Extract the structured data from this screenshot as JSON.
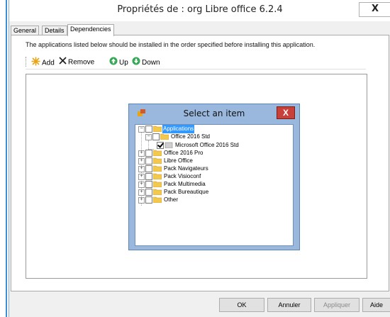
{
  "window": {
    "title": "Propriétés de : org Libre office 6.2.4",
    "close_glyph": "X"
  },
  "tabs": [
    {
      "label": "General",
      "active": false
    },
    {
      "label": "Details",
      "active": false
    },
    {
      "label": "Dependencies",
      "active": true
    }
  ],
  "panel": {
    "description": "The applications listed below should be installed in the order specified before installing this application."
  },
  "toolbar": {
    "add_label": "Add",
    "remove_label": "Remove",
    "up_label": "Up",
    "down_label": "Down"
  },
  "dialog": {
    "title": "Select an item",
    "close_glyph": "X",
    "tree": {
      "root": {
        "label": "Applications",
        "checked": false,
        "selected": true,
        "expanded": true
      },
      "office2016std": {
        "label": "Office 2016 Std",
        "checked": false,
        "expanded": true
      },
      "msoffice2016std": {
        "label": "Microsoft Office 2016 Std",
        "checked": true
      },
      "office2016pro": {
        "label": "Office 2016 Pro",
        "checked": false
      },
      "libreoffice": {
        "label": "Libre Office",
        "checked": false
      },
      "navigateurs": {
        "label": "Pack Navigateurs",
        "checked": false
      },
      "visioconf": {
        "label": "Pack Visioconf",
        "checked": false
      },
      "multimedia": {
        "label": "Pack Multimedia",
        "checked": false
      },
      "bureautique": {
        "label": "Pack Bureautique",
        "checked": false
      },
      "other": {
        "label": "Other",
        "checked": false
      }
    }
  },
  "buttons": {
    "ok": "OK",
    "annuler": "Annuler",
    "appliquer": "Appliquer",
    "aide": "Aide"
  },
  "colors": {
    "accent": "#3c8fd6",
    "dialog_frame": "#9ab8de",
    "close_red": "#c8403a",
    "selection": "#3399ff"
  }
}
